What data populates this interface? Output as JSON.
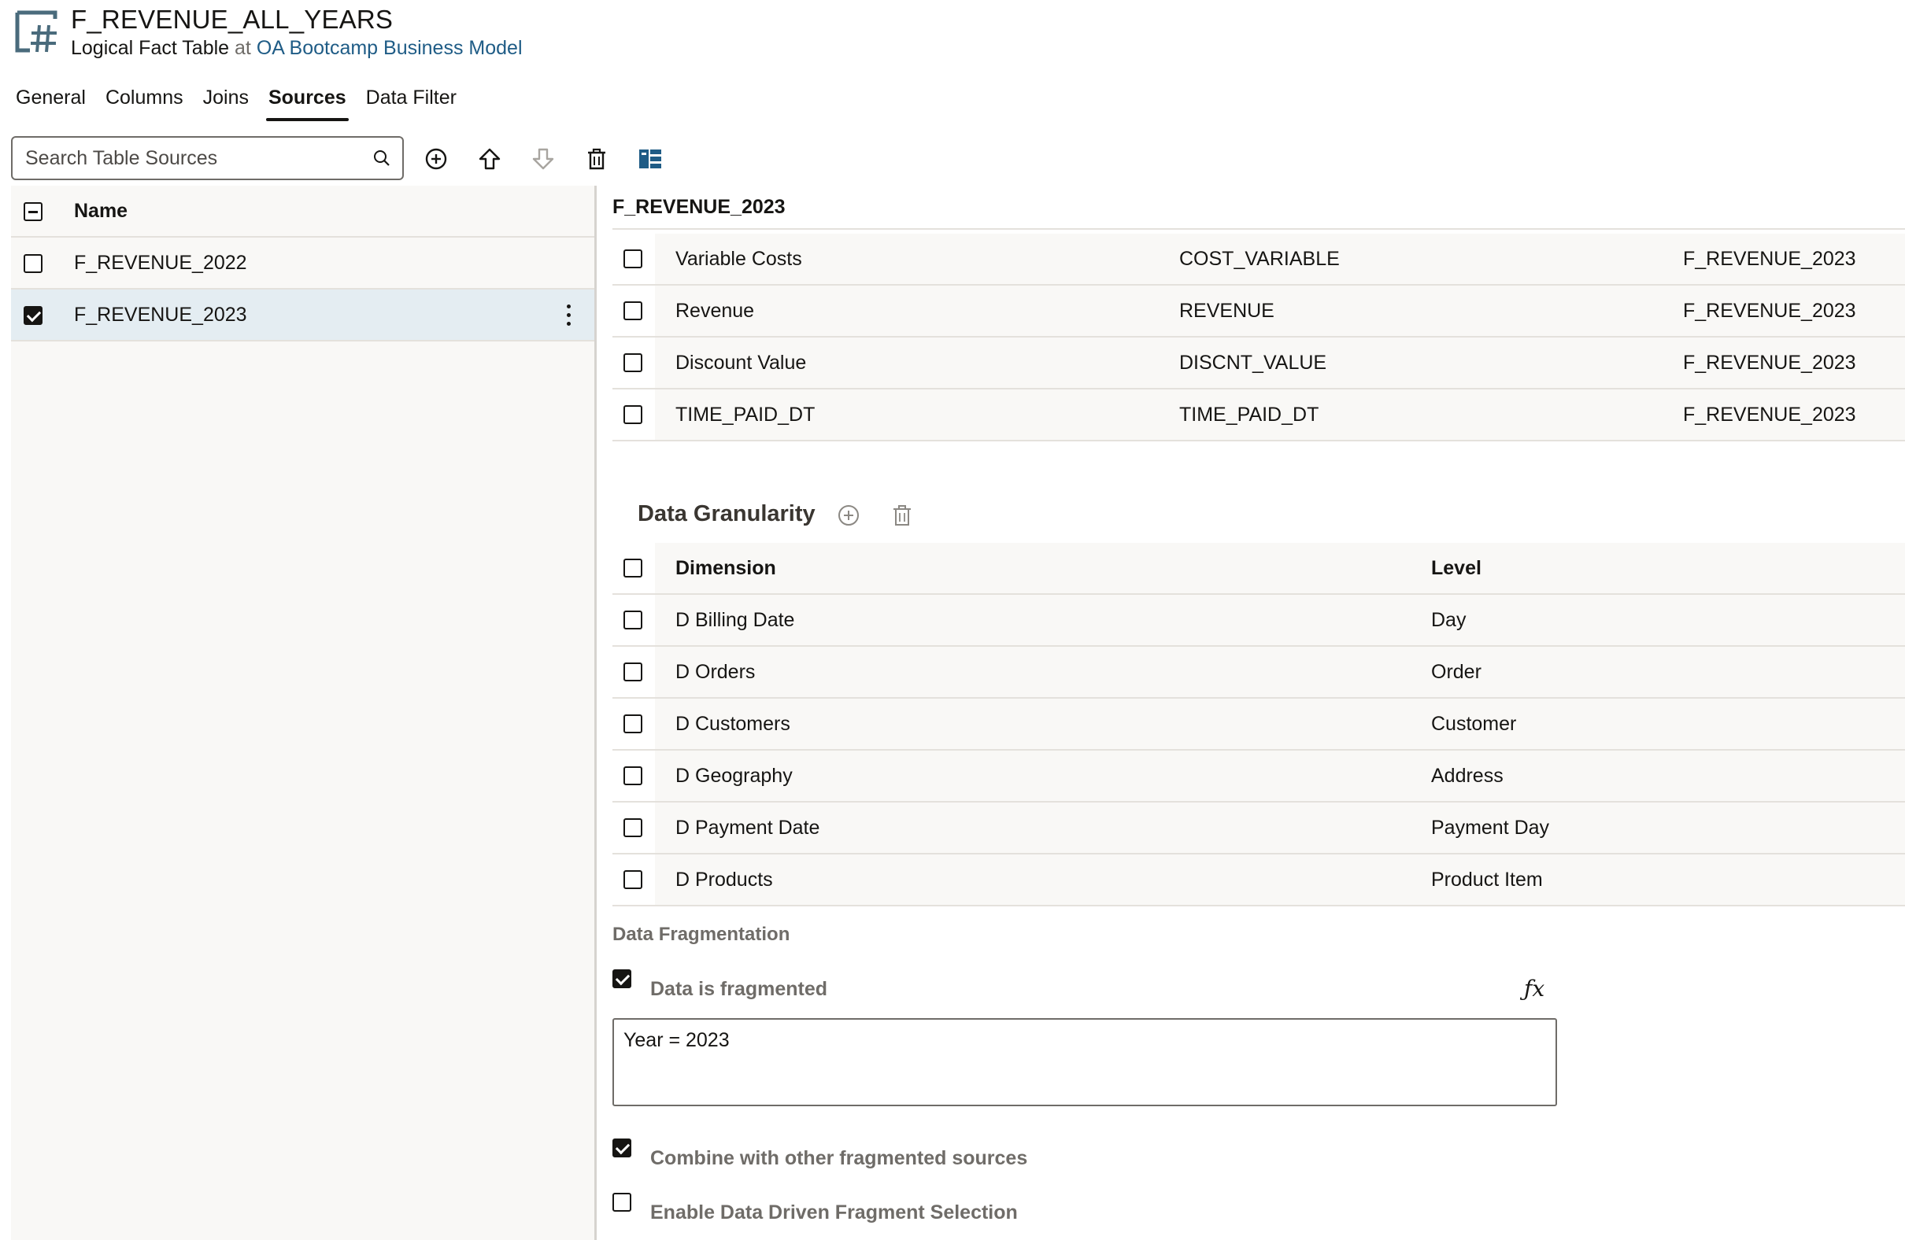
{
  "header": {
    "title": "F_REVENUE_ALL_YEARS",
    "object_type": "Logical Fact Table",
    "at_word": "at",
    "parent_link": "OA Bootcamp Business Model",
    "icon": "logical-fact-table-icon"
  },
  "tabs": [
    {
      "label": "General",
      "active": false
    },
    {
      "label": "Columns",
      "active": false
    },
    {
      "label": "Joins",
      "active": false
    },
    {
      "label": "Sources",
      "active": true
    },
    {
      "label": "Data Filter",
      "active": false
    }
  ],
  "toolbar": {
    "search_placeholder": "Search Table Sources",
    "icons": [
      "search-icon",
      "add-icon",
      "move-up-icon",
      "move-down-icon",
      "delete-icon",
      "detail-view-icon"
    ]
  },
  "sources": {
    "header": "Name",
    "items": [
      {
        "name": "F_REVENUE_2022",
        "checked": false,
        "selected": false
      },
      {
        "name": "F_REVENUE_2023",
        "checked": true,
        "selected": true
      }
    ]
  },
  "detail": {
    "title": "F_REVENUE_2023",
    "mappings": [
      {
        "column": "Variable Costs",
        "expression": "COST_VARIABLE",
        "source": "F_REVENUE_2023"
      },
      {
        "column": "Revenue",
        "expression": "REVENUE",
        "source": "F_REVENUE_2023"
      },
      {
        "column": "Discount Value",
        "expression": "DISCNT_VALUE",
        "source": "F_REVENUE_2023"
      },
      {
        "column": "TIME_PAID_DT",
        "expression": "TIME_PAID_DT",
        "source": "F_REVENUE_2023"
      }
    ],
    "granularity": {
      "title": "Data Granularity",
      "headers": {
        "dimension": "Dimension",
        "level": "Level"
      },
      "rows": [
        {
          "dimension": "D Billing Date",
          "level": "Day"
        },
        {
          "dimension": "D Orders",
          "level": "Order"
        },
        {
          "dimension": "D Customers",
          "level": "Customer"
        },
        {
          "dimension": "D Geography",
          "level": "Address"
        },
        {
          "dimension": "D Payment Date",
          "level": "Payment Day"
        },
        {
          "dimension": "D Products",
          "level": "Product Item"
        }
      ]
    },
    "fragmentation": {
      "title": "Data Fragmentation",
      "is_fragmented_label": "Data is fragmented",
      "is_fragmented": true,
      "fx_label": "ƒx",
      "expression": "Year = 2023",
      "combine_label": "Combine with other fragmented sources",
      "combine": true,
      "data_driven_label": "Enable Data Driven Fragment Selection",
      "data_driven": false
    }
  },
  "colors": {
    "text": "#161513",
    "link": "#1f5c86",
    "muted": "#6f6c68",
    "selected_row": "#e4edf2",
    "panel_bg": "#f9f8f6",
    "icon_accent": "#1f5c86"
  }
}
